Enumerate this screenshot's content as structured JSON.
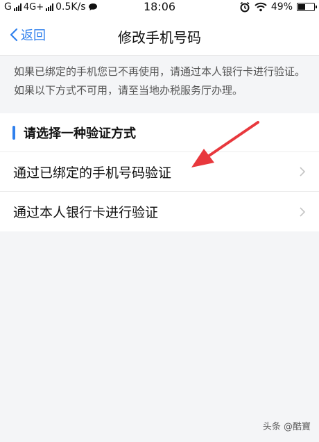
{
  "status_bar": {
    "carrier": "G",
    "network": "4G+",
    "speed": "0.5K/s",
    "time": "18:06",
    "battery": "49%",
    "battery_level": 0.49,
    "icons": [
      "signal-icon",
      "message-bubble-icon",
      "alarm-icon",
      "wifi-icon",
      "battery-icon"
    ]
  },
  "header": {
    "back_label": "返回",
    "title": "修改手机号码"
  },
  "notice": {
    "text": "如果已绑定的手机您已不再使用，请通过本人银行卡进行验证。如果以下方式不可用，请至当地办税服务厅办理。"
  },
  "section": {
    "title": "请选择一种验证方式",
    "options": [
      {
        "label": "通过已绑定的手机号码验证"
      },
      {
        "label": "通过本人银行卡进行验证"
      }
    ]
  },
  "annotation": {
    "color": "#e8383d"
  },
  "watermark": {
    "text": "头条 @酷寶"
  },
  "colors": {
    "accent": "#2f80ed",
    "background": "#f4f5f7"
  }
}
